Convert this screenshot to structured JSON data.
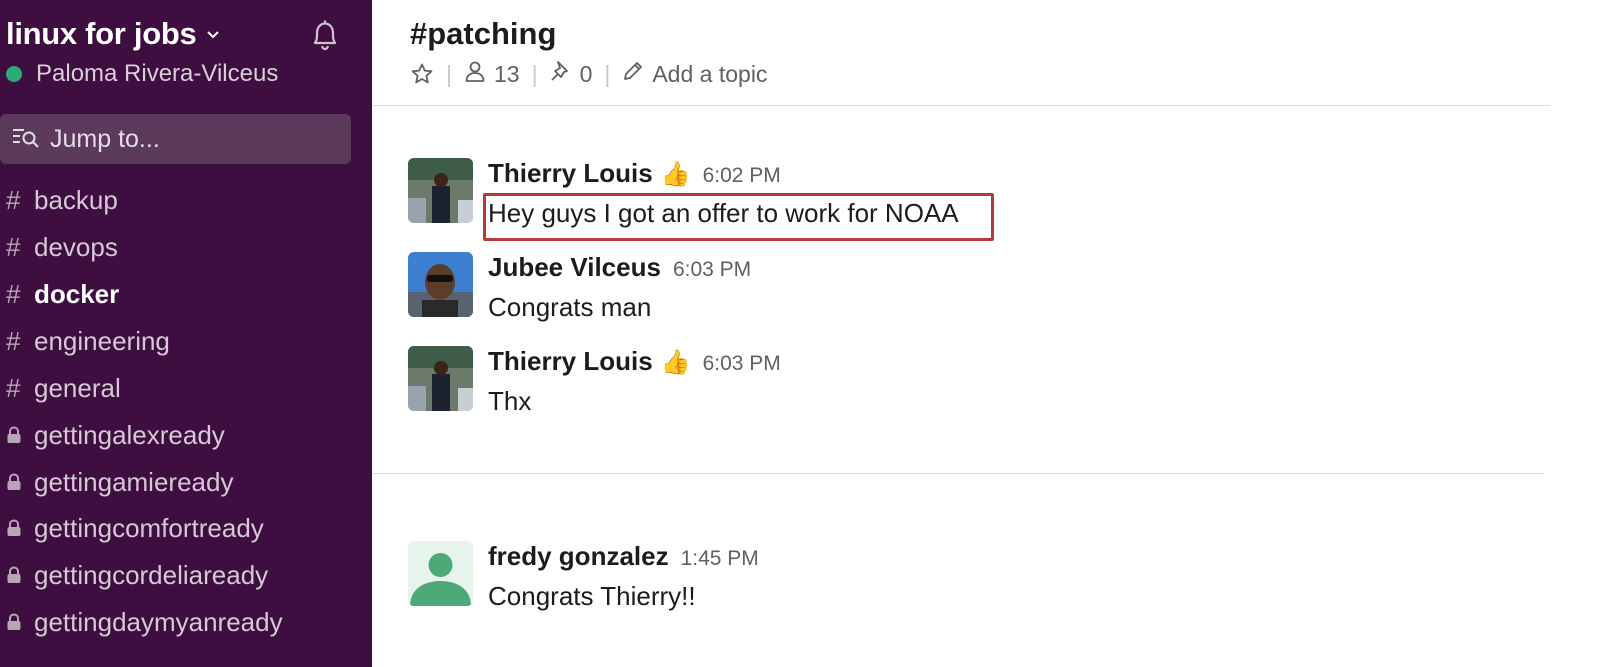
{
  "sidebar": {
    "workspace_name": "linux for jobs",
    "user_name": "Paloma Rivera-Vilceus",
    "jump_to_label": "Jump to...",
    "channels": [
      {
        "prefix": "#",
        "label": "backup",
        "private": false,
        "bold": false
      },
      {
        "prefix": "#",
        "label": "devops",
        "private": false,
        "bold": false
      },
      {
        "prefix": "#",
        "label": "docker",
        "private": false,
        "bold": true
      },
      {
        "prefix": "#",
        "label": "engineering",
        "private": false,
        "bold": false
      },
      {
        "prefix": "#",
        "label": "general",
        "private": false,
        "bold": false
      },
      {
        "prefix": "lock-icon",
        "label": "gettingalexready",
        "private": true,
        "bold": false
      },
      {
        "prefix": "lock-icon",
        "label": "gettingamieready",
        "private": true,
        "bold": false
      },
      {
        "prefix": "lock-icon",
        "label": "gettingcomfortready",
        "private": true,
        "bold": false
      },
      {
        "prefix": "lock-icon",
        "label": "gettingcordeliaready",
        "private": true,
        "bold": false
      },
      {
        "prefix": "lock-icon",
        "label": "gettingdaymyanready",
        "private": true,
        "bold": false
      }
    ]
  },
  "header": {
    "channel_name": "#patching",
    "member_count": "13",
    "pinned_count": "0",
    "add_topic_label": "Add a topic"
  },
  "messages": [
    {
      "sender": "Thierry Louis",
      "emoji": "👍",
      "time": "6:02 PM",
      "text": "Hey guys I got an offer to work for NOAA",
      "highlighted": true
    },
    {
      "sender": "Jubee Vilceus",
      "emoji": "",
      "time": "6:03 PM",
      "text": "Congrats man",
      "highlighted": false
    },
    {
      "sender": "Thierry Louis",
      "emoji": "👍",
      "time": "6:03 PM",
      "text": "Thx",
      "highlighted": false
    },
    {
      "sender": "fredy gonzalez",
      "emoji": "",
      "time": "1:45 PM",
      "text": "Congrats Thierry!!",
      "highlighted": false
    }
  ],
  "colors": {
    "sidebar_bg": "#3f0e40",
    "presence": "#2bac76",
    "highlight_border": "#b63a3a"
  }
}
